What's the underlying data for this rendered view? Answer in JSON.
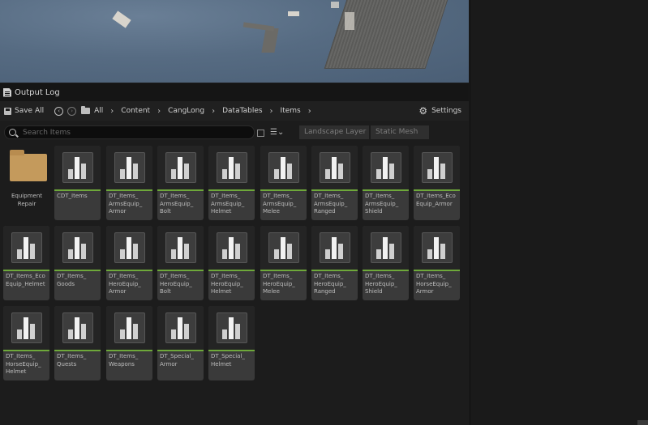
{
  "output_log": {
    "title": "Output Log"
  },
  "toolbar": {
    "save_all": "Save All",
    "breadcrumb": [
      "All",
      "Content",
      "CangLong",
      "DataTables",
      "Items"
    ],
    "settings": "Settings"
  },
  "search": {
    "placeholder": "Search Items"
  },
  "filter_chips": [
    "Landscape Layer",
    "Static Mesh"
  ],
  "assets": [
    {
      "name": "Equipment Repair",
      "type": "folder"
    },
    {
      "name": "CDT_Items",
      "type": "datatable"
    },
    {
      "name": "DT_Items_ ArmsEquip_ Armor",
      "type": "datatable"
    },
    {
      "name": "DT_Items_ ArmsEquip_ Bolt",
      "type": "datatable"
    },
    {
      "name": "DT_Items_ ArmsEquip_ Helmet",
      "type": "datatable"
    },
    {
      "name": "DT_Items_ ArmsEquip_ Melee",
      "type": "datatable"
    },
    {
      "name": "DT_Items_ ArmsEquip_ Ranged",
      "type": "datatable"
    },
    {
      "name": "DT_Items_ ArmsEquip_ Shield",
      "type": "datatable"
    },
    {
      "name": "DT_Items_Eco Equip_Armor",
      "type": "datatable"
    },
    {
      "name": "DT_Items_Eco Equip_Helmet",
      "type": "datatable"
    },
    {
      "name": "DT_Items_ Goods",
      "type": "datatable"
    },
    {
      "name": "DT_Items_ HeroEquip_ Armor",
      "type": "datatable"
    },
    {
      "name": "DT_Items_ HeroEquip_ Bolt",
      "type": "datatable"
    },
    {
      "name": "DT_Items_ HeroEquip_ Helmet",
      "type": "datatable"
    },
    {
      "name": "DT_Items_ HeroEquip_ Melee",
      "type": "datatable"
    },
    {
      "name": "DT_Items_ HeroEquip_ Ranged",
      "type": "datatable"
    },
    {
      "name": "DT_Items_ HeroEquip_ Shield",
      "type": "datatable"
    },
    {
      "name": "DT_Items_ HorseEquip_ Armor",
      "type": "datatable"
    },
    {
      "name": "DT_Items_ HorseEquip_ Helmet",
      "type": "datatable"
    },
    {
      "name": "DT_Items_ Quests",
      "type": "datatable"
    },
    {
      "name": "DT_Items_ Weapons",
      "type": "datatable"
    },
    {
      "name": "DT_Special_ Armor",
      "type": "datatable"
    },
    {
      "name": "DT_Special_ Helmet",
      "type": "datatable"
    }
  ],
  "colors": {
    "accent_underline": "#6ea83a",
    "folder": "#c49a5c"
  }
}
